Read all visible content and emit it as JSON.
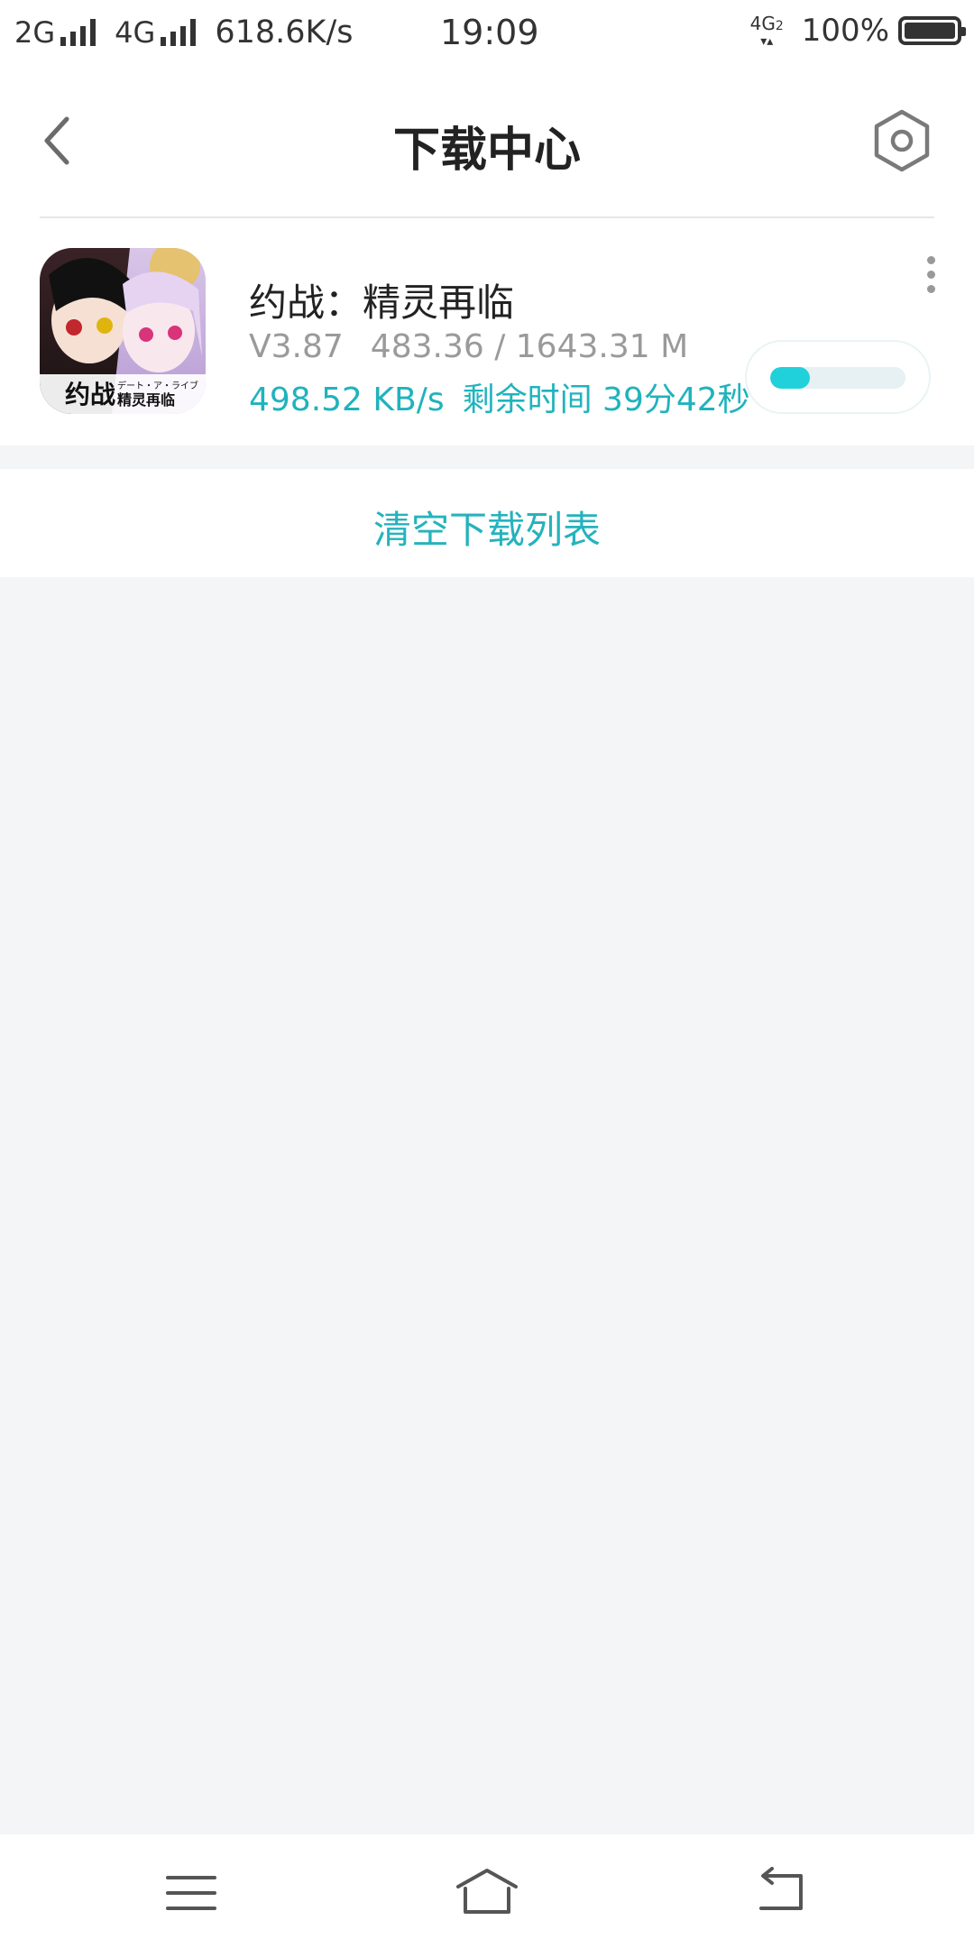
{
  "status_bar": {
    "net1": "2G",
    "net2": "4G",
    "speed": "618.6K/s",
    "time": "19:09",
    "net_indicator_top": "4G",
    "net_indicator_sub": "2",
    "battery": "100%"
  },
  "header": {
    "title": "下载中心",
    "back_icon": "chevron-left-icon",
    "settings_icon": "hexagon-gear-icon"
  },
  "downloads": [
    {
      "name": "约战：精灵再临",
      "version": "V3.87",
      "progress_text": "483.36 / 1643.31 M",
      "speed": "498.52 KB/s",
      "remaining": "剩余时间 39分42秒",
      "progress_fraction": 0.294,
      "icon_label_main": "约战",
      "icon_label_sub": "デート・ア・ライブ",
      "icon_label_sub2": "精灵再临"
    }
  ],
  "clear_list_label": "清空下载列表",
  "nav": {
    "menu_icon": "menu-icon",
    "home_icon": "home-icon",
    "back_icon": "back-arrow-icon"
  },
  "colors": {
    "accent": "#1fb3bd",
    "progress": "#20d1db",
    "background": "#f4f5f7"
  }
}
